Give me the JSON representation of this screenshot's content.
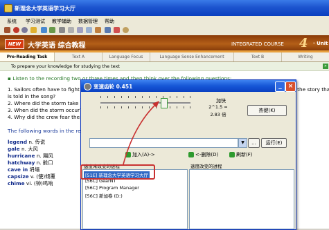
{
  "window": {
    "title": "新理念大学英语学习大厅"
  },
  "menu": [
    "系统",
    "学习测试",
    "教学辅助",
    "数据管理",
    "帮助"
  ],
  "banner": {
    "badge": "NEW",
    "title": "大学英语 综合教程",
    "course": "INTEGRATED COURSE",
    "number": "4",
    "unit": "· Unit 1"
  },
  "tabs": [
    "Pre-Reading Task",
    "Text A",
    "Language Focus",
    "Language Sense Enhancement",
    "Text B",
    "Writing"
  ],
  "subbar": {
    "text": "To prepare your knowledge for studying the text",
    "go": "»"
  },
  "content": {
    "instruction": "Listen to the recording two or three times and then think over the following questions:",
    "q1a": "1. Sailors often have to fight against the forces of nature. Sometimes they win; sometimes they lose. Who wins in the story that",
    "q1b": "is told in the song?",
    "q2": "2. Where did the storm take p",
    "q3": "3. When did the storm occur?",
    "q4": "4. Why did the crew fear the",
    "words_intro": "The following words in the re",
    "vocab": [
      {
        "word": "legend",
        "def": "n. 传说"
      },
      {
        "word": "gale",
        "def": "n. 大风"
      },
      {
        "word": "hurricane",
        "def": "n. 飓风"
      },
      {
        "word": "hatchway",
        "def": "n. 舱口"
      },
      {
        "word": "cave in",
        "def": "坍塌"
      },
      {
        "word": "capsize",
        "def": "v. (使)倾覆"
      },
      {
        "word": "chime",
        "def": "vi. (钟)鸣响"
      }
    ]
  },
  "dialog": {
    "title": "变速齿轮 0.451",
    "min": "_",
    "close": "×",
    "speed_label": "加快",
    "speed_value": "2^1.5 =",
    "speed_times": "2.83 倍",
    "hotkey": "热键(K)",
    "dots": "...",
    "run": "运行(E)",
    "add": "加入(A)->",
    "remove": "<-删除(D)",
    "refresh": "刷新(F)",
    "selectable_label": "速度未改变的进程",
    "speed_label_right": "速度改变的进程",
    "processes": [
      "[51E] 新理念大学英语学习大厅",
      "[56C] GearNT",
      "[56C] Program Manager",
      "[56C] 新加卷 (D:)"
    ]
  }
}
